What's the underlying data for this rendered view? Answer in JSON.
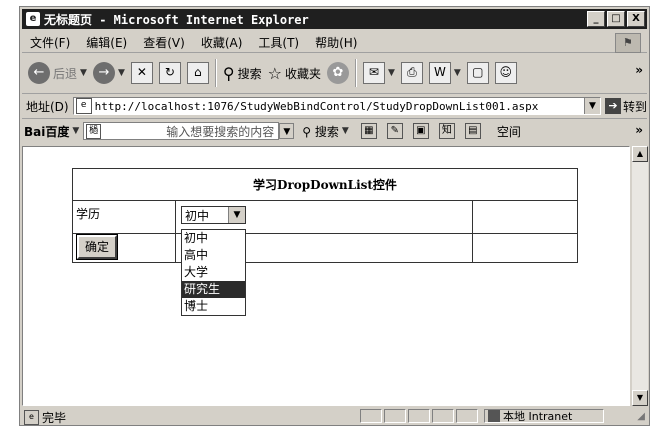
{
  "window": {
    "title": "无标题页 - Microsoft Internet Explorer",
    "ie_icon": "e",
    "controls": [
      "_",
      "□",
      "X"
    ]
  },
  "menu": {
    "items": [
      "文件(F)",
      "编辑(E)",
      "查看(V)",
      "收藏(A)",
      "工具(T)",
      "帮助(H)"
    ]
  },
  "toolbar": {
    "back": "后退",
    "search": "搜索",
    "favorites": "收藏夹",
    "more": "»"
  },
  "address": {
    "label": "地址(D)",
    "url": "http://localhost:1076/StudyWebBindControl/StudyDropDownList001.aspx",
    "go": "转到"
  },
  "baidu": {
    "logo": "Bai百度",
    "placeholder": "输入想要搜索的内容",
    "search": "搜索",
    "space": "空间",
    "more": "»"
  },
  "page": {
    "caption": "学习DropDownList控件",
    "label_education": "学历",
    "selected": "初中",
    "confirm": "确定",
    "options": [
      "初中",
      "高中",
      "大学",
      "研究生",
      "博士"
    ],
    "highlighted_index": 3
  },
  "status": {
    "text": "完毕",
    "zone": "本地 Intranet"
  }
}
